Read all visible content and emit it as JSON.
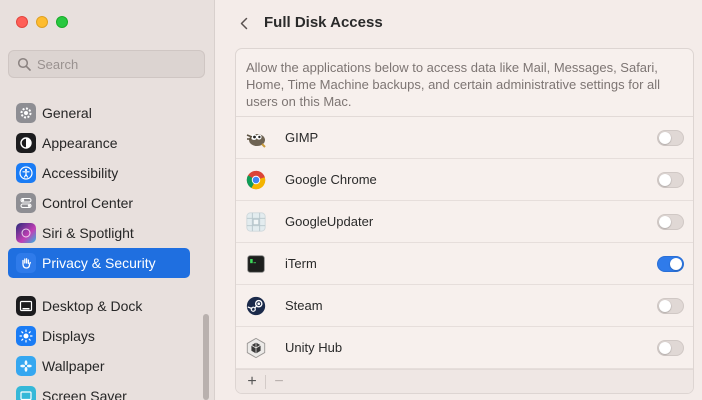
{
  "window": {
    "title": "Full Disk Access"
  },
  "search": {
    "placeholder": "Search",
    "value": ""
  },
  "sidebar": {
    "items": [
      {
        "label": "General",
        "icon": "gear-icon",
        "color": "#8e8e93"
      },
      {
        "label": "Appearance",
        "icon": "appearance-icon",
        "color": "#1c1c1e"
      },
      {
        "label": "Accessibility",
        "icon": "accessibility-icon",
        "color": "#1a7cf5"
      },
      {
        "label": "Control Center",
        "icon": "control-center-icon",
        "color": "#8e8e93"
      },
      {
        "label": "Siri & Spotlight",
        "icon": "siri-icon",
        "color": "#5b3fd6"
      },
      {
        "label": "Privacy & Security",
        "icon": "hand-icon",
        "color": "#2f7bea",
        "selected": true
      },
      {
        "label": "Desktop & Dock",
        "icon": "dock-icon",
        "color": "#1c1c1e"
      },
      {
        "label": "Displays",
        "icon": "displays-icon",
        "color": "#1a7cf5"
      },
      {
        "label": "Wallpaper",
        "icon": "wallpaper-icon",
        "color": "#35a7f0"
      },
      {
        "label": "Screen Saver",
        "icon": "screen-saver-icon",
        "color": "#35b8d8"
      }
    ]
  },
  "main": {
    "description": "Allow the applications below to access data like Mail, Messages, Safari, Home, Time Machine backups, and certain administrative settings for all users on this Mac.",
    "apps": [
      {
        "name": "GIMP",
        "icon": "gimp-icon",
        "enabled": false
      },
      {
        "name": "Google Chrome",
        "icon": "chrome-icon",
        "enabled": false
      },
      {
        "name": "GoogleUpdater",
        "icon": "google-updater-icon",
        "enabled": false
      },
      {
        "name": "iTerm",
        "icon": "iterm-icon",
        "enabled": true
      },
      {
        "name": "Steam",
        "icon": "steam-icon",
        "enabled": false
      },
      {
        "name": "Unity Hub",
        "icon": "unity-hub-icon",
        "enabled": false
      }
    ],
    "footer": {
      "add_label": "+",
      "remove_label": "−"
    }
  },
  "colors": {
    "accent": "#1f6fe0",
    "toggle_on": "#2f7bea"
  }
}
